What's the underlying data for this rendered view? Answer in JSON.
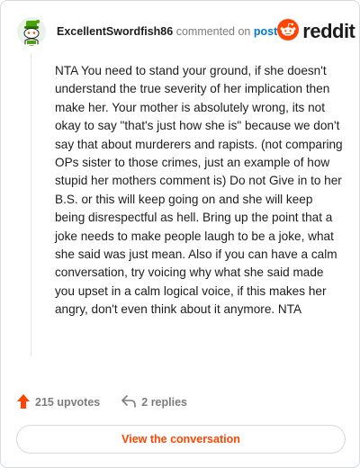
{
  "header": {
    "username": "ExcellentSwordfish86",
    "commented_on": "commented on",
    "post_link": "post",
    "brand": "reddit"
  },
  "comment": {
    "body": "NTA You need to stand your ground, if she doesn't understand the true severity of her implication then make her. Your mother is absolutely wrong, its not okay to say \"that's just how she is\" because we don't say that about murderers and rapists. (not comparing OPs sister to those crimes, just an example of how stupid her mothers comment is) Do not Give in to her B.S. or this will keep going on and she will keep being disrespectful as hell. Bring up the point that a joke needs to make people laugh to be a joke, what she said was just mean. Also if you can have a calm conversation, try voicing why what she said made you upset in a calm logical voice, if this makes her angry, don't even think about it anymore. NTA"
  },
  "actions": {
    "upvotes": "215 upvotes",
    "replies": "2 replies"
  },
  "footer": {
    "view_button": "View the conversation"
  },
  "colors": {
    "brand_orange": "#ff4500",
    "link_blue": "#0079d3",
    "text_dark": "#1c1c1c",
    "text_muted": "#7c7c7c"
  },
  "icons": {
    "avatar": "snoo-avatar-icon",
    "logo": "reddit-logo-icon",
    "upvote": "upvote-arrow-icon",
    "reply": "reply-arrow-icon"
  }
}
